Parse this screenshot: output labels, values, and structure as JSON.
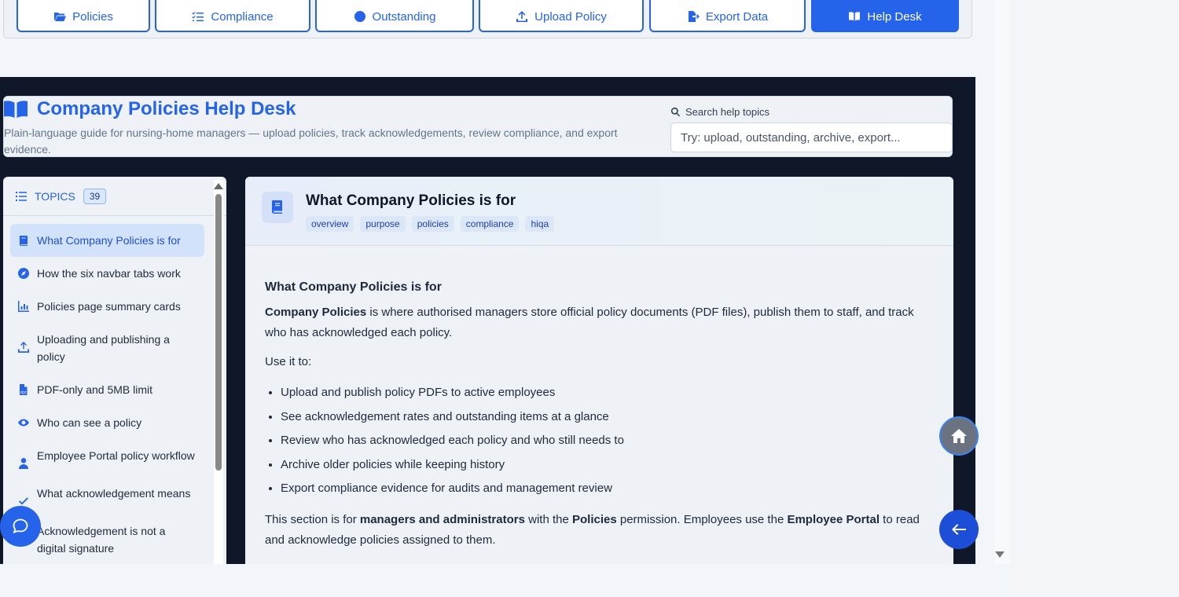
{
  "navbar": {
    "tabs": [
      {
        "label": "Policies",
        "icon": "folder-open-icon"
      },
      {
        "label": "Compliance",
        "icon": "list-check-icon"
      },
      {
        "label": "Outstanding",
        "icon": "clock-icon"
      },
      {
        "label": "Upload Policy",
        "icon": "upload-icon"
      },
      {
        "label": "Export Data",
        "icon": "file-export-icon"
      },
      {
        "label": "Help Desk",
        "icon": "book-open-icon",
        "active": true
      }
    ]
  },
  "header": {
    "title": "Company Policies Help Desk",
    "subtitle": "Plain-language guide for nursing-home managers — upload policies, track acknowledgements, review compliance, and export evidence.",
    "search_label": "Search help topics",
    "search_placeholder": "Try: upload, outstanding, archive, export..."
  },
  "topics": {
    "heading": "TOPICS",
    "count": "39",
    "items": [
      {
        "label": "What Company Policies is for",
        "icon": "book-icon",
        "active": true
      },
      {
        "label": "How the six navbar tabs work",
        "icon": "compass-icon"
      },
      {
        "label": "Policies page summary cards",
        "icon": "chart-bar-icon"
      },
      {
        "label": "Uploading and publishing a policy",
        "icon": "upload-icon"
      },
      {
        "label": "PDF-only and 5MB limit",
        "icon": "file-pdf-icon"
      },
      {
        "label": "Who can see a policy",
        "icon": "eye-icon"
      },
      {
        "label": "Employee Portal policy workflow",
        "icon": "user-icon"
      },
      {
        "label": "What acknowledgement means",
        "icon": "check-icon"
      },
      {
        "label": "Acknowledgement is not a digital signature",
        "icon": "signature-icon"
      }
    ]
  },
  "article": {
    "title": "What Company Policies is for",
    "tags": [
      "overview",
      "purpose",
      "policies",
      "compliance",
      "hiqa"
    ],
    "body_heading": "What Company Policies is for",
    "intro_bold": "Company Policies",
    "intro_rest": " is where authorised managers store official policy documents (PDF files), publish them to staff, and track who has acknowledged each policy.",
    "use_it_to": "Use it to:",
    "bullets": [
      "Upload and publish policy PDFs to active employees",
      "See acknowledgement rates and outstanding items at a glance",
      "Review who has acknowledged each policy and who still needs to",
      "Archive older policies while keeping history",
      "Export compliance evidence for audits and management review"
    ],
    "closing": {
      "p1": "This section is for ",
      "b1": "managers and administrators",
      "p2": " with the ",
      "b2": "Policies",
      "p3": " permission. Employees use the ",
      "b3": "Employee Portal",
      "p4": " to read and acknowledge policies assigned to them."
    }
  },
  "fabs": {
    "home": "home-icon",
    "back": "arrow-left-icon",
    "chat": "chat-icon"
  }
}
